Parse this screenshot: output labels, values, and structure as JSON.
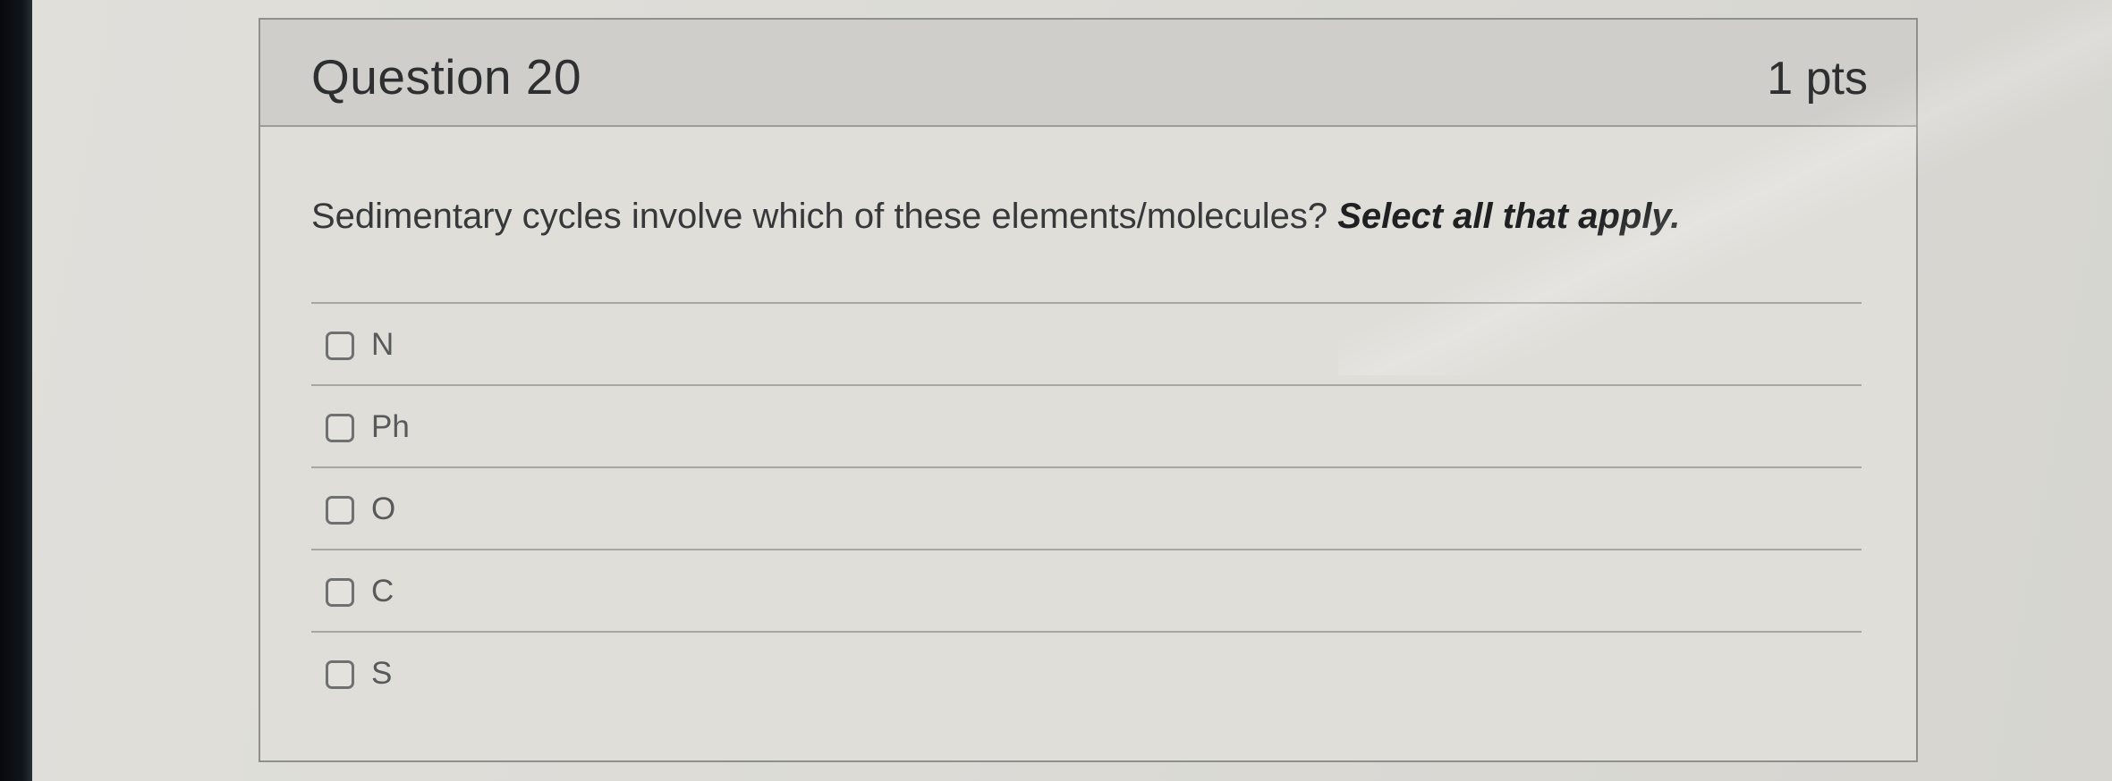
{
  "question": {
    "title": "Question 20",
    "points": "1 pts",
    "text": "Sedimentary cycles involve which of these elements/molecules?",
    "instruction": "Select all that apply."
  },
  "answers": [
    {
      "label": "N",
      "checked": false
    },
    {
      "label": "Ph",
      "checked": false
    },
    {
      "label": "O",
      "checked": false
    },
    {
      "label": "C",
      "checked": false
    },
    {
      "label": "S",
      "checked": false
    }
  ]
}
